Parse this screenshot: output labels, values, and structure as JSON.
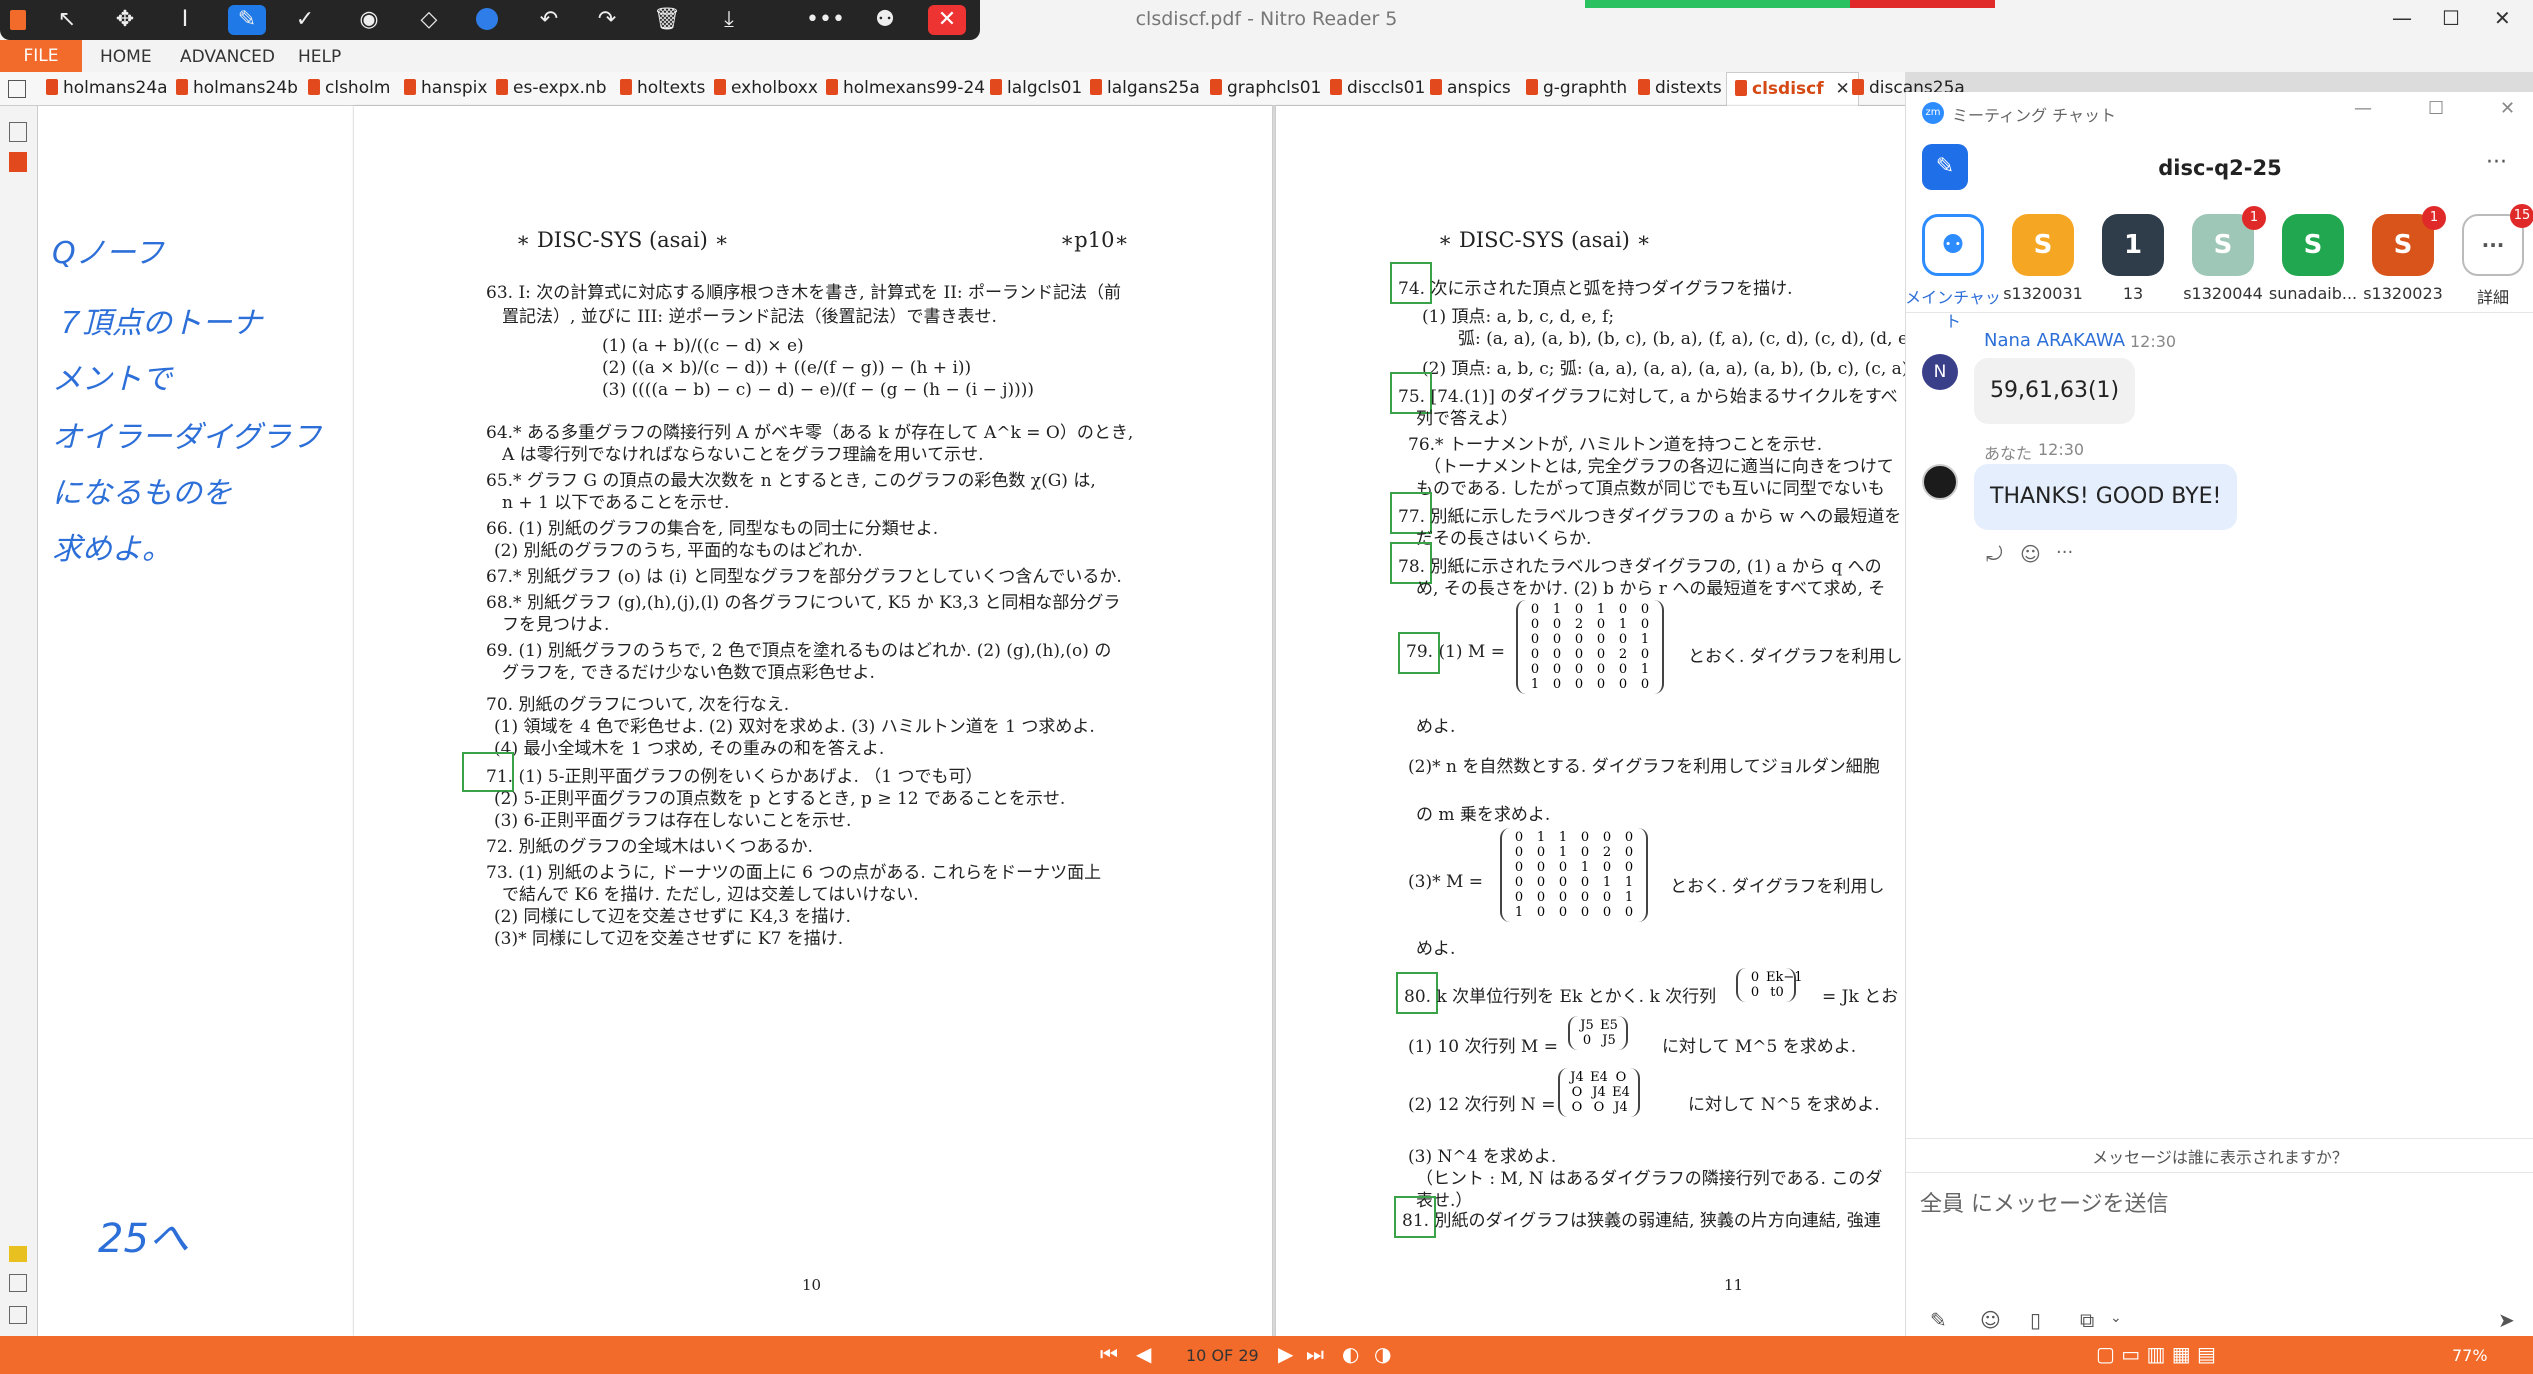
{
  "window": {
    "title": "clsdiscf.pdf - Nitro Reader 5"
  },
  "menu": {
    "file": "FILE",
    "home": "HOME",
    "advanced": "ADVANCED",
    "help": "HELP"
  },
  "tabs": [
    "holmans24a",
    "holmans24b",
    "clsholm",
    "hanspix",
    "es-expx.nb",
    "holtexts",
    "exholboxx",
    "holmexans99-24",
    "lalgcls01",
    "lalgans25a",
    "graphcls01",
    "disccls01",
    "anspics",
    "g-graphth",
    "distexts",
    "clsdiscf",
    "discans25a"
  ],
  "notes": {
    "lines": [
      "Qノーフ",
      "７頂点のトーナ",
      "メントで",
      "オイラーダイグラフ",
      "になるものを",
      "求めよ。"
    ],
    "footer": "25へ"
  },
  "page10": {
    "header_left": "∗ DISC-SYS (asai) ∗",
    "header_right": "∗p10∗",
    "lines": [
      "63. I: 次の計算式に対応する順序根つき木を書き, 計算式を II: ポーランド記法（前",
      "置記法）, 並びに III: 逆ポーランド記法（後置記法）で書き表せ.",
      "(1) (a + b)/((c − d) × e)",
      "(2) ((a × b)/(c − d)) + ((e/(f − g)) − (h + i))",
      "(3) ((((a − b) − c) − d) − e)/(f − (g − (h − (i − j))))",
      "64.* ある多重グラフの隣接行列 A がベキ零（ある k が存在して A^k = O）のとき,",
      "A は零行列でなければならないことをグラフ理論を用いて示せ.",
      "65.* グラフ G の頂点の最大次数を n とするとき, このグラフの彩色数 χ(G) は,",
      "n + 1 以下であることを示せ.",
      "66. (1) 別紙のグラフの集合を, 同型なもの同士に分類せよ.",
      "(2) 別紙のグラフのうち, 平面的なものはどれか.",
      "67.* 別紙グラフ (o) は (i) と同型なグラフを部分グラフとしていくつ含んでいるか.",
      "68.* 別紙グラフ (g),(h),(j),(l) の各グラフについて, K5 か K3,3 と同相な部分グラ",
      "フを見つけよ.",
      "69. (1) 別紙グラフのうちで, 2 色で頂点を塗れるものはどれか. (2) (g),(h),(o) の",
      "グラフを, できるだけ少ない色数で頂点彩色せよ.",
      "70. 別紙のグラフについて, 次を行なえ.",
      "(1) 領域を 4 色で彩色せよ. (2) 双対を求めよ. (3) ハミルトン道を 1 つ求めよ.",
      "(4) 最小全域木を 1 つ求め, その重みの和を答えよ.",
      "71. (1) 5-正則平面グラフの例をいくらかあげよ. （1 つでも可）",
      "(2) 5-正則平面グラフの頂点数を p とするとき, p ≥ 12 であることを示せ.",
      "(3) 6-正則平面グラフは存在しないことを示せ.",
      "72. 別紙のグラフの全域木はいくつあるか.",
      "73. (1) 別紙のように, ドーナツの面上に 6 つの点がある. これらをドーナツ面上",
      "で結んで K6 を描け. ただし, 辺は交差してはいけない.",
      "(2) 同様にして辺を交差させずに K4,3 を描け.",
      "(3)* 同様にして辺を交差させずに K7 を描け."
    ],
    "page_number": "10"
  },
  "page11": {
    "header_left": "∗ DISC-SYS (asai) ∗",
    "lines": [
      "74. 次に示された頂点と弧を持つダイグラフを描け.",
      "(1) 頂点: a, b, c, d, e, f;",
      "弧: (a, a), (a, b), (b, c), (b, a), (f, a), (c, d), (c, d), (d, e), (e, f",
      "(2) 頂点: a, b, c; 弧: (a, a), (a, a), (a, a), (a, b), (b, c), (c, a)",
      "75. [74.(1)] のダイグラフに対して, a から始まるサイクルをすべ",
      "列で答えよ）",
      "76.* トーナメントが, ハミルトン道を持つことを示せ.",
      "（トーナメントとは, 完全グラフの各辺に適当に向きをつけて",
      "ものである. したがって頂点数が同じでも互いに同型でないも",
      "77. 別紙に示したラベルつきダイグラフの a から w への最短道を",
      "だその長さはいくらか.",
      "78. 別紙に示されたラベルつきダイグラフの, (1) a から q への",
      "め, その長さをかけ. (2) b から r への最短道をすべて求め, そ",
      "79. (1) M =",
      "とおく. ダイグラフを利用し",
      "めよ.",
      "(2)* n を自然数とする. ダイグラフを利用してジョルダン細胞",
      "の m 乗を求めよ.",
      "(3)* M =",
      "とおく. ダイグラフを利用し",
      "めよ.",
      "80. k 次単位行列を Ek とかく. k 次行列",
      "= Jk とお",
      "(1) 10 次行列 M =",
      "に対して M^5 を求めよ.",
      "(2) 12 次行列 N =",
      "に対して N^5 を求めよ.",
      "(3) N^4 を求めよ.",
      "（ヒント : M, N はあるダイグラフの隣接行列である. このダ",
      "表せ.）",
      "81. 別紙のダイグラフは狭義の弱連結, 狭義の片方向連結, 強連"
    ],
    "matrix1": [
      [
        "0",
        "1",
        "0",
        "1",
        "0",
        "0"
      ],
      [
        "0",
        "0",
        "2",
        "0",
        "1",
        "0"
      ],
      [
        "0",
        "0",
        "0",
        "0",
        "0",
        "1"
      ],
      [
        "0",
        "0",
        "0",
        "0",
        "2",
        "0"
      ],
      [
        "0",
        "0",
        "0",
        "0",
        "0",
        "1"
      ],
      [
        "1",
        "0",
        "0",
        "0",
        "0",
        "0"
      ]
    ],
    "matrix2": [
      [
        "0",
        "1",
        "1",
        "0",
        "0",
        "0"
      ],
      [
        "0",
        "0",
        "1",
        "0",
        "2",
        "0"
      ],
      [
        "0",
        "0",
        "0",
        "1",
        "0",
        "0"
      ],
      [
        "0",
        "0",
        "0",
        "0",
        "1",
        "1"
      ],
      [
        "0",
        "0",
        "0",
        "0",
        "0",
        "1"
      ],
      [
        "1",
        "0",
        "0",
        "0",
        "0",
        "0"
      ]
    ],
    "matrix80": [
      [
        "0",
        "Ek−1"
      ],
      [
        "0",
        "t0"
      ]
    ],
    "matrixM": [
      [
        "J5",
        "E5"
      ],
      [
        "0",
        "J5"
      ]
    ],
    "matrixN": [
      [
        "J4",
        "E4",
        "O"
      ],
      [
        "O",
        "J4",
        "E4"
      ],
      [
        "O",
        "O",
        "J4"
      ]
    ],
    "page_number": "11"
  },
  "bottom": {
    "page_indicator": "10 OF 29",
    "zoom": "77%"
  },
  "zoom": {
    "title": "ミーティング チャット",
    "channel": "disc-q2-25",
    "participants": [
      {
        "label": "メインチャット",
        "initial": "",
        "color": "#ffffff",
        "badge": ""
      },
      {
        "label": "s1320031",
        "initial": "S",
        "color": "#f5a623",
        "badge": ""
      },
      {
        "label": "13",
        "initial": "1",
        "color": "#2f3c4a",
        "badge": ""
      },
      {
        "label": "s1320044",
        "initial": "S",
        "color": "#9ec7b7",
        "badge": "1"
      },
      {
        "label": "sunadaib...",
        "initial": "S",
        "color": "#21a74f",
        "badge": ""
      },
      {
        "label": "s1320023",
        "initial": "S",
        "color": "#d9541a",
        "badge": "1"
      },
      {
        "label": "詳細",
        "initial": "",
        "color": "#ffffff",
        "badge": "15"
      }
    ],
    "messages": [
      {
        "sender": "Nana ARAKAWA",
        "time": "12:30",
        "text": "59,61,63(1)",
        "avatar": "N"
      },
      {
        "sender": "あなた",
        "time": "12:30",
        "text": "THANKS! GOOD BYE!",
        "avatar": ""
      }
    ],
    "visibility_notice": "メッセージは誰に表示されますか？",
    "input_placeholder": "全員 にメッセージを送信"
  }
}
